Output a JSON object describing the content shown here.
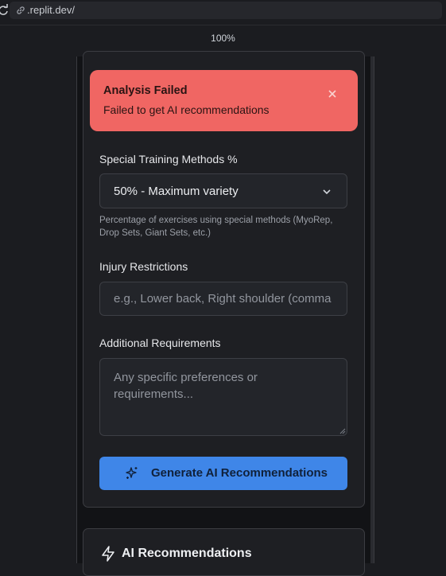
{
  "browser": {
    "url": ".replit.dev/",
    "zoom": "100%"
  },
  "toast": {
    "title": "Analysis Failed",
    "message": "Failed to get AI recommendations"
  },
  "form": {
    "special_methods": {
      "label": "Special Training Methods %",
      "selected": "50% - Maximum variety",
      "hint": "Percentage of exercises using special methods (MyoRep, Drop Sets, Giant Sets, etc.)"
    },
    "injury": {
      "label": "Injury Restrictions",
      "placeholder": "e.g., Lower back, Right shoulder (comma"
    },
    "additional": {
      "label": "Additional Requirements",
      "placeholder": "Any specific preferences or requirements..."
    },
    "generate_button": "Generate AI Recommendations"
  },
  "recommendations": {
    "title": "AI Recommendations"
  },
  "colors": {
    "toast_bg": "#f06663",
    "button_bg": "#3f86e8"
  }
}
